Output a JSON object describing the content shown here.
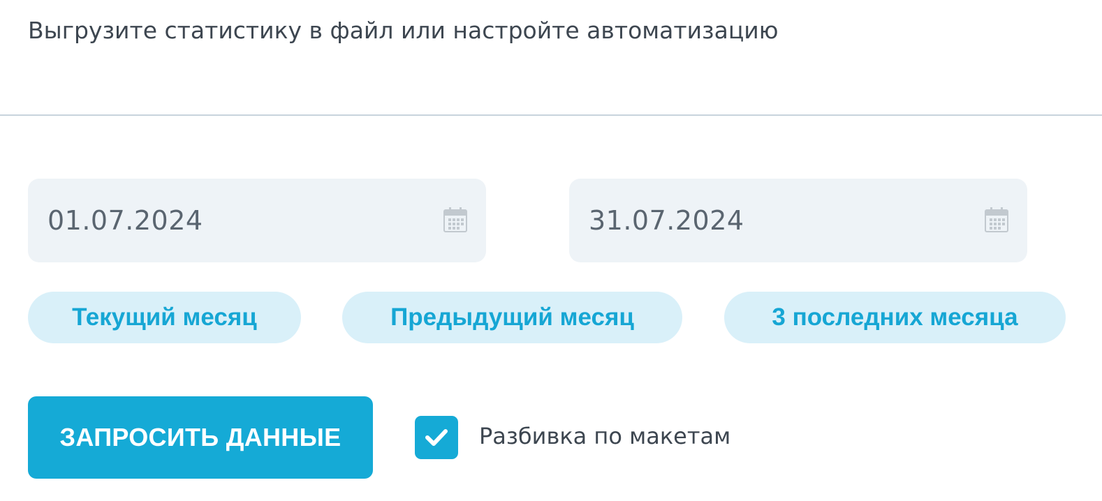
{
  "header": {
    "subtitle": "Выгрузите статистику в файл или настройте автоматизацию"
  },
  "date_range": {
    "start": {
      "value": "01.07.2024",
      "icon": "calendar-icon"
    },
    "end": {
      "value": "31.07.2024",
      "icon": "calendar-icon"
    }
  },
  "presets": {
    "current_month": "Текущий месяц",
    "previous_month": "Предыдущий месяц",
    "last_three_months": "3 последних месяца"
  },
  "actions": {
    "request_data_label": "ЗАПРОСИТЬ ДАННЫЕ"
  },
  "options": {
    "split_by_layouts": {
      "label": "Разбивка по макетам",
      "checked": true,
      "icon": "checkmark-icon"
    }
  },
  "colors": {
    "accent": "#15aad6",
    "preset_background": "#d9f0f9",
    "field_background": "#eef3f7",
    "text": "#3d4650"
  }
}
